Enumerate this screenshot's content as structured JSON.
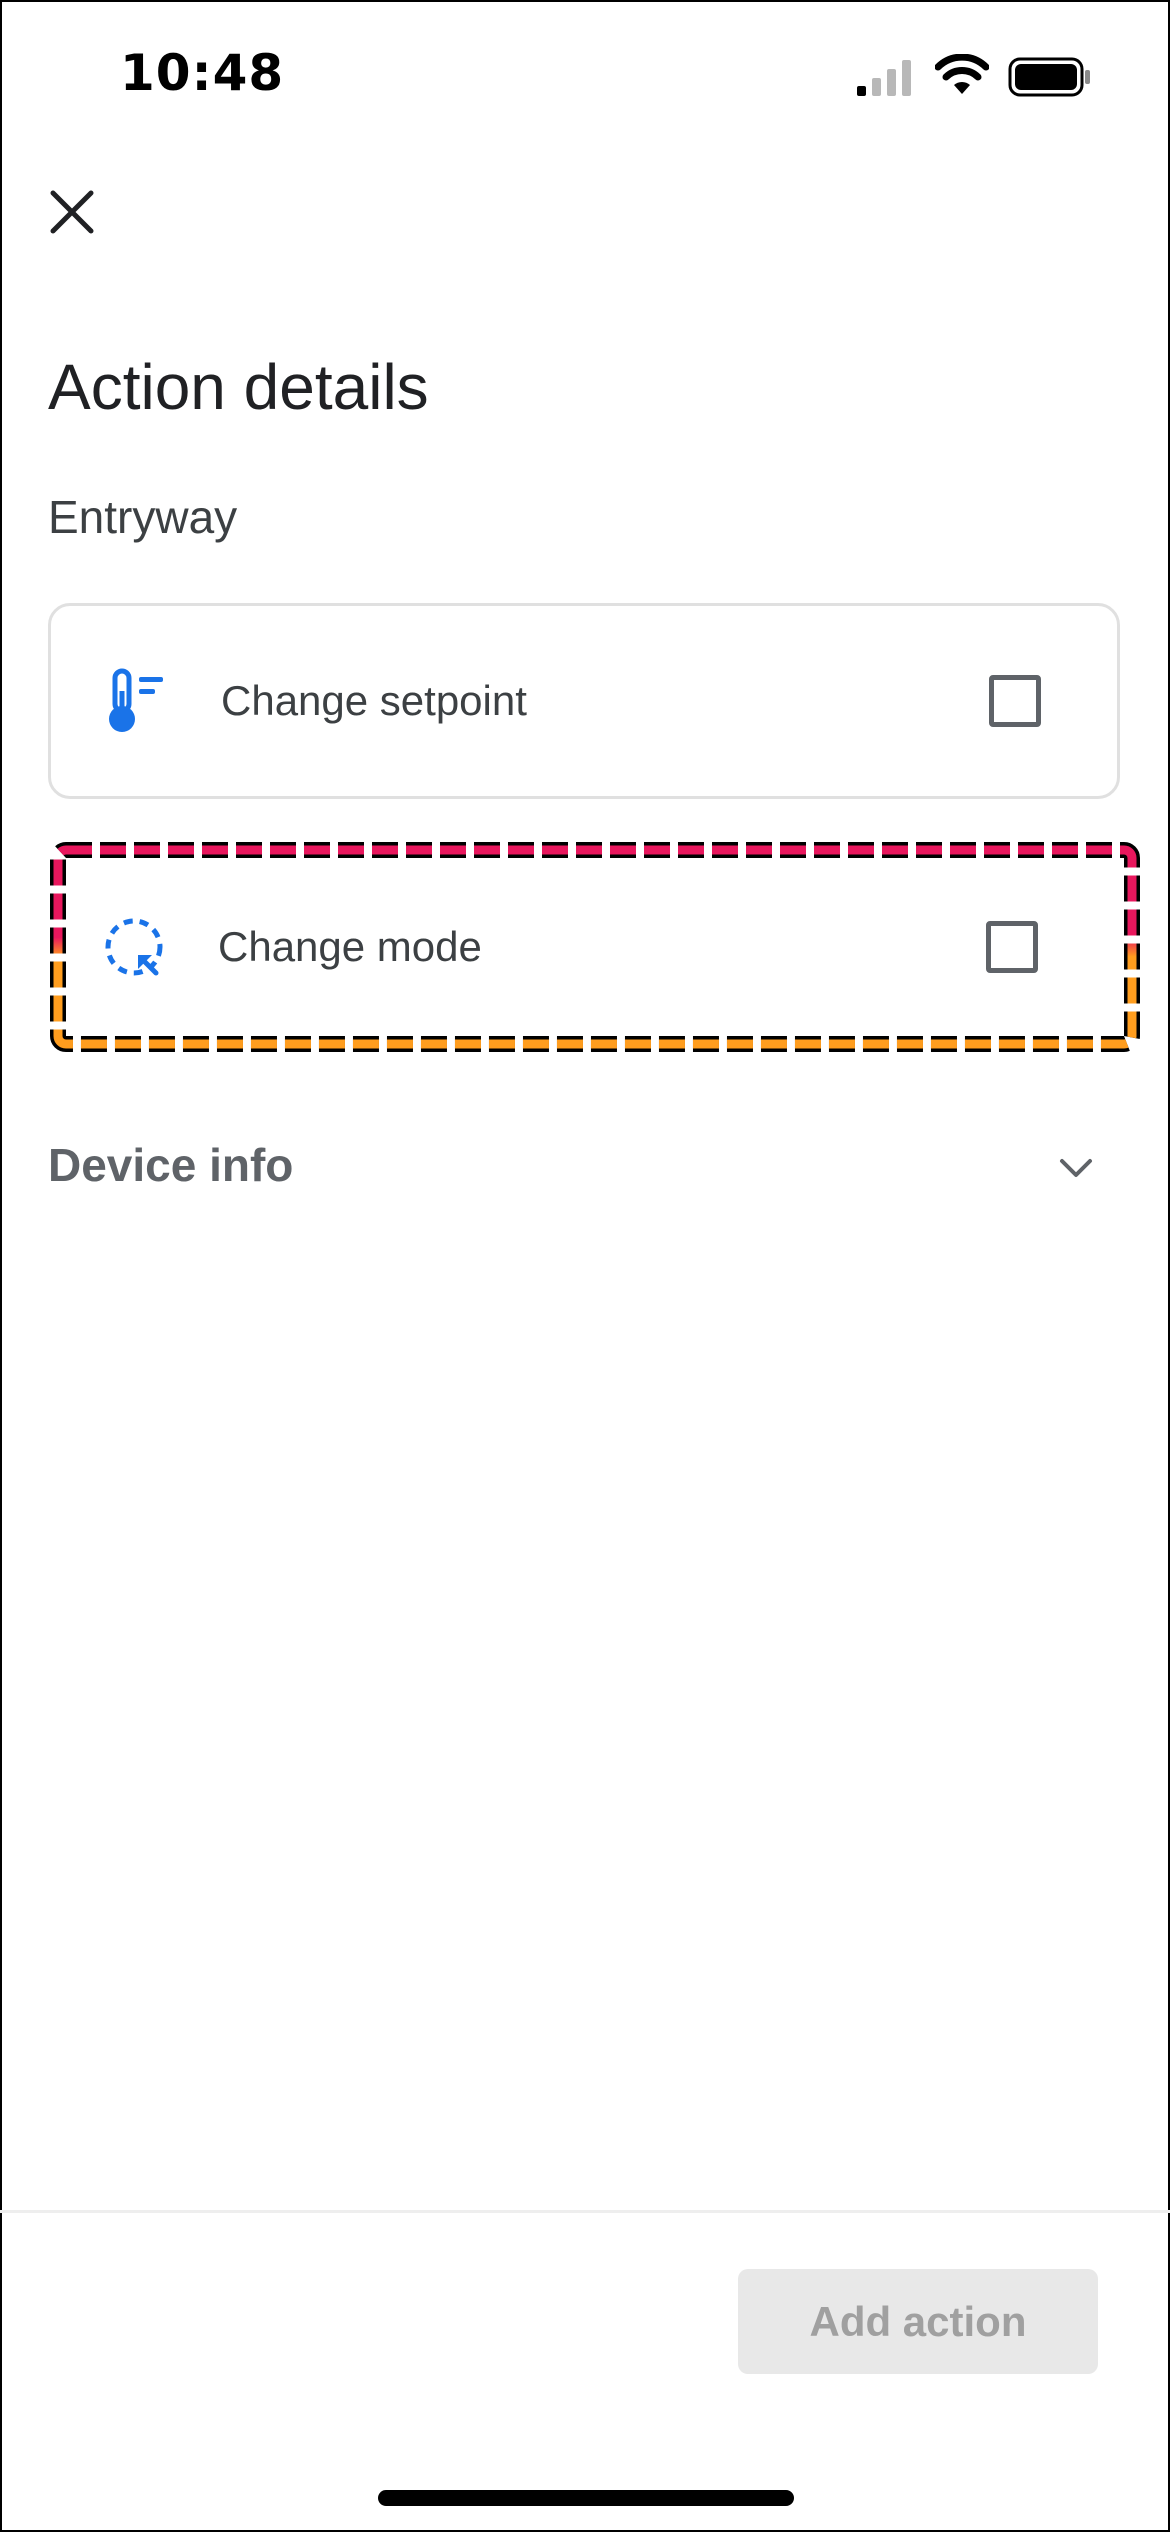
{
  "status_bar": {
    "time": "10:48",
    "signal_icon": "cellular-signal-icon",
    "wifi_icon": "wifi-icon",
    "battery_icon": "battery-icon"
  },
  "header": {
    "close_icon": "close-icon",
    "title": "Action details"
  },
  "device": {
    "room_name": "Entryway"
  },
  "actions": [
    {
      "label": "Change setpoint",
      "icon": "thermometer-icon",
      "checked": false
    },
    {
      "label": "Change mode",
      "icon": "mode-cycle-icon",
      "checked": false
    }
  ],
  "device_info": {
    "label": "Device info",
    "icon": "chevron-down-icon"
  },
  "footer": {
    "add_action_label": "Add action"
  },
  "colors": {
    "accent_blue": "#1a73e8",
    "highlight_red": "#e8175d",
    "highlight_orange": "#ff9d1e",
    "text_primary": "#202124",
    "text_secondary": "#5f6368"
  }
}
